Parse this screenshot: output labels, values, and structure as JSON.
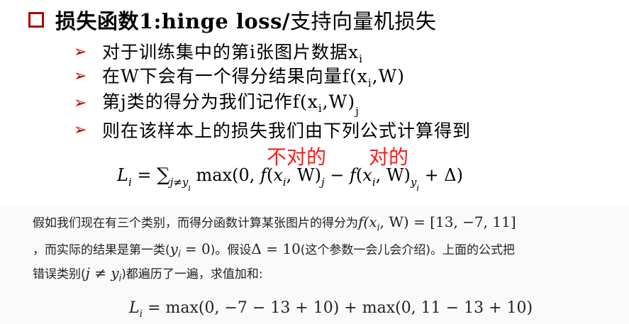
{
  "title": {
    "bold_part": "损失函数1:hinge loss/",
    "rest_part": "支持向量机损失"
  },
  "bullets": [
    {
      "text": "对于训练集中的第i张图片数据x",
      "sub": "i",
      "tail": ""
    },
    {
      "text": "在W下会有一个得分结果向量f(x",
      "sub": "i",
      "tail": ",W)"
    },
    {
      "text": "第j类的得分为我们记作f(x",
      "sub": "i",
      "tail": ",W)",
      "sub2": "j"
    },
    {
      "text": "则在该样本上的损失我们由下列公式计算得到",
      "sub": "",
      "tail": ""
    }
  ],
  "annotations": {
    "wrong": "不对的",
    "right": "对的"
  },
  "formula_main": {
    "lhs": "L",
    "lhs_sub": "i",
    "eq": " = ",
    "sum": "∑",
    "sum_sub": "j≠y",
    "sum_sub_sub": "i",
    "body1": " max(0, ",
    "f1": "f",
    "arg1": "(x",
    "arg1_sub": "i",
    "arg1_tail": ", W)",
    "sub_j": "j",
    "minus": " − ",
    "f2": "f",
    "arg2": "(x",
    "arg2_sub": "i",
    "arg2_tail": ", W)",
    "sub_yi": "y",
    "sub_yi_sub": "i",
    "end": " + Δ)"
  },
  "paragraph": {
    "line1_text": "假如我们现在有三个类别，而得分函数计算某张图片的得分为",
    "line1_math": "f(x",
    "line1_math_sub": "i",
    "line1_math_tail": ", W) = [13, −7, 11]",
    "line2_text_a": "，而实际的结果是第一类(",
    "line2_math": "y",
    "line2_math_sub": "i",
    "line2_math_tail": " = 0",
    "line2_text_b": ")。假设",
    "line2_delta": "Δ = 10",
    "line2_text_c": "(这个参数一会儿会介绍)。上面的公式把",
    "line3_text_a": "错误类别(",
    "line3_math": "j ≠ y",
    "line3_math_sub": "i",
    "line3_text_b": ")都遍历了一遍，求值加和:"
  },
  "formula_bottom": {
    "lhs": "L",
    "lhs_sub": "i",
    "rhs": " = max(0, −7 − 13 + 10) + max(0, 11 − 13 + 10)"
  },
  "colors": {
    "accent_red": "#b00000",
    "annotation_red": "#ff1a1a"
  }
}
